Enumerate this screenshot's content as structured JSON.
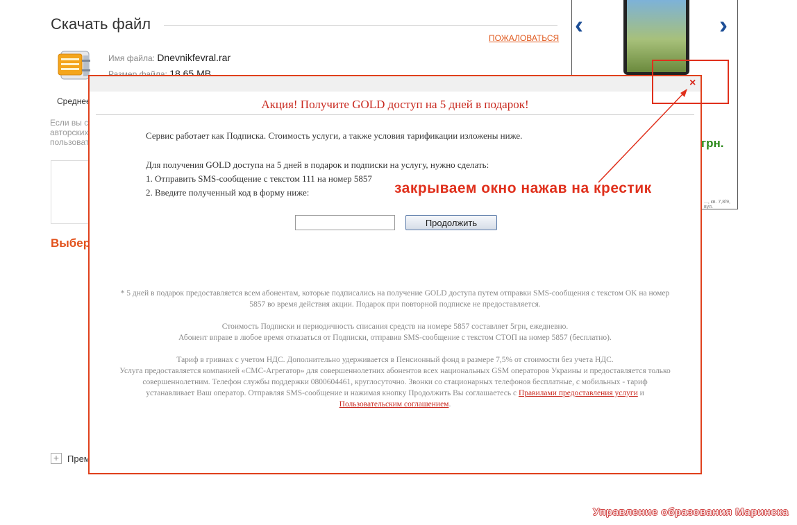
{
  "page": {
    "title": "Скачать файл",
    "report_link": "ПОЖАЛОВАТЬСЯ",
    "file_name_label": "Имя файла:",
    "file_name": "Dnevnikfevral.rar",
    "file_size_label": "Размер файла:",
    "file_size": "18.65 MB",
    "tab_label": "Среднее",
    "left_text_lines": [
      "Если вы с",
      "авторских",
      "пользоват"
    ],
    "choose_label": "Выбер",
    "prem_label": "Прем"
  },
  "ad": {
    "price": "грн.",
    "addr": "..., кв. 7,8/9, вул."
  },
  "modal": {
    "title": "Акция! Получите GOLD доступ на 5 дней в подарок!",
    "intro": "Сервис работает как Подписка. Стоимость услуги, а также условия тарификации изложены ниже.",
    "steps_heading": "Для получения GOLD доступа на 5 дней в подарок и подписки на услугу, нужно сделать:",
    "step1": "1. Отправить SMS-сообщение с текстом 111 на номер 5857",
    "step2": "2. Введите полученный код в форму ниже:",
    "continue_label": "Продолжить",
    "close_glyph": "×",
    "fine1": "* 5 дней в подарок предоставляется всем абонентам, которые подписались на получение GOLD доступа путем отправки SMS-сообщения с текстом OK на номер 5857 во время действия акции. Подарок при повторной подписке не предоставляется.",
    "fine2_line1": "Стоимость Подписки и периодичность списания средств на номере 5857 составляет 5грн, ежедневно.",
    "fine2_line2": "Абонент вправе в любое время отказаться от Подписки, отправив SMS-сообщение с текстом СТОП на номер 5857 (бесплатно).",
    "fine3_line1": "Тариф в гривнах с учетом НДС. Дополнительно удерживается в Пенсионный фонд в размере 7,5% от стоимости без учета НДС.",
    "fine3_body": "Услуга предоставляется компанией «СМС-Агрегатор» для совершеннолетних абонентов всех национальных GSM операторов Украины и предоставляется только совершеннолетним. Телефон службы поддержки 0800604461, круглосуточно. Звонки со стационарных телефонов бесплатные, с мобильных - тариф устанавливает Ваш оператор. Отправляя SMS-сообщение и нажимая кнопку Продолжить Вы соглашаетесь с",
    "rules_link": "Правилами предоставления услуги",
    "and_text": "и",
    "agreement_link": "Пользовательским соглашением",
    "period": "."
  },
  "annotation": {
    "text": "закрываем окно нажав на крестик"
  },
  "watermark": "Управление образования Маринска",
  "colors": {
    "accent": "#e0401c",
    "link_orange": "#e0581c",
    "title_red": "#c8281e",
    "price_green": "#2c8a1a"
  }
}
